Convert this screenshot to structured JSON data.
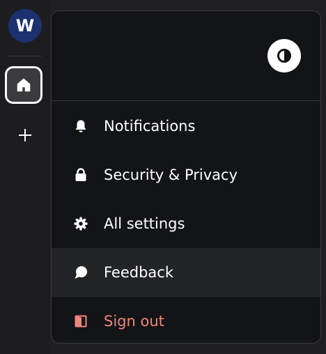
{
  "rail": {
    "avatar_initial": "W",
    "items": [
      {
        "name": "home",
        "icon": "home-icon"
      },
      {
        "name": "add",
        "icon": "plus-icon"
      }
    ]
  },
  "menu": {
    "theme_toggle_icon": "contrast-icon",
    "items": [
      {
        "label": "Notifications",
        "icon": "bell-icon"
      },
      {
        "label": "Security & Privacy",
        "icon": "lock-icon"
      },
      {
        "label": "All settings",
        "icon": "gear-icon"
      },
      {
        "label": "Feedback",
        "icon": "chat-bubble-icon"
      },
      {
        "label": "Sign out",
        "icon": "door-exit-icon"
      }
    ]
  },
  "colors": {
    "avatar_bg": "#1c3270",
    "menu_bg": "#131417",
    "highlight_bg": "#232428",
    "danger": "#f0857b"
  }
}
